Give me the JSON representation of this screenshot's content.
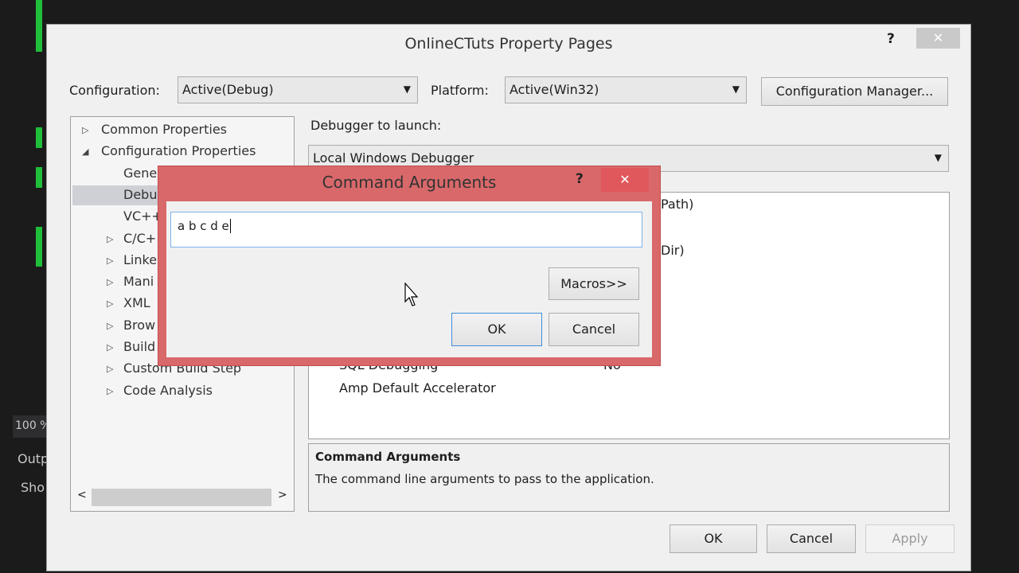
{
  "background": {
    "zoom": "100 %",
    "output_label": "Outp",
    "show_label": "Sho"
  },
  "dialog": {
    "title": "OnlineCTuts Property Pages",
    "help": "?",
    "close": "✕",
    "configuration_label": "Configuration:",
    "configuration_value": "Active(Debug)",
    "platform_label": "Platform:",
    "platform_value": "Active(Win32)",
    "config_manager": "Configuration Manager...",
    "tree": [
      {
        "label": "Common Properties",
        "expander": "▷",
        "indent": 0
      },
      {
        "label": "Configuration Properties",
        "expander": "◢",
        "indent": 0
      },
      {
        "label": "Gene",
        "expander": "",
        "indent": 1
      },
      {
        "label": "Debu",
        "expander": "",
        "indent": 1,
        "selected": true
      },
      {
        "label": "VC++",
        "expander": "",
        "indent": 1
      },
      {
        "label": "C/C+",
        "expander": "▷",
        "indent": 1
      },
      {
        "label": "Linke",
        "expander": "▷",
        "indent": 1
      },
      {
        "label": "Mani",
        "expander": "▷",
        "indent": 1
      },
      {
        "label": "XML",
        "expander": "▷",
        "indent": 1
      },
      {
        "label": "Brow",
        "expander": "▷",
        "indent": 1
      },
      {
        "label": "Build",
        "expander": "▷",
        "indent": 1
      },
      {
        "label": "Custom Build Step",
        "expander": "▷",
        "indent": 1
      },
      {
        "label": "Code Analysis",
        "expander": "▷",
        "indent": 1
      }
    ],
    "debugger_label": "Debugger to launch:",
    "debugger_value": "Local Windows Debugger",
    "grid": [
      {
        "name": "",
        "value": "Path)"
      },
      {
        "name": "",
        "value": "Dir)"
      },
      {
        "name": "SQL Debugging",
        "value": "No"
      },
      {
        "name": "Amp Default Accelerator",
        "value": ""
      }
    ],
    "desc_title": "Command Arguments",
    "desc_text": "The command line arguments to pass to the application.",
    "ok": "OK",
    "cancel": "Cancel",
    "apply": "Apply"
  },
  "cmd_dialog": {
    "title": "Command Arguments",
    "help": "?",
    "close": "✕",
    "input_value": "a b c d e",
    "macros": "Macros>>",
    "ok": "OK",
    "cancel": "Cancel"
  }
}
